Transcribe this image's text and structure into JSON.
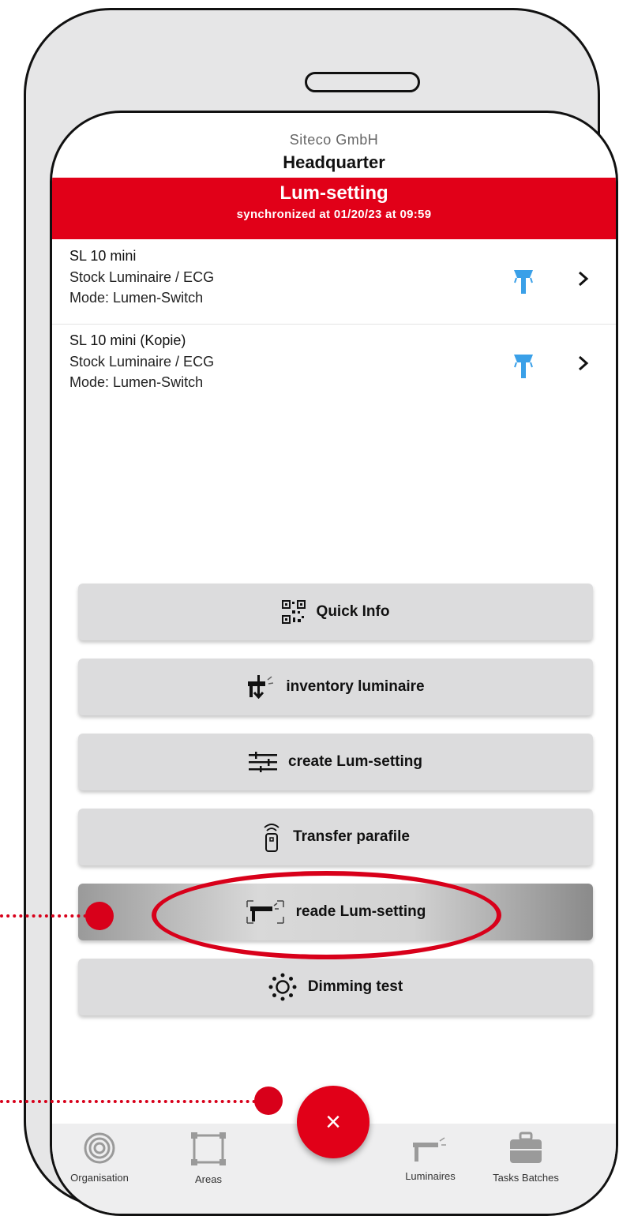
{
  "header": {
    "organisation": "Siteco GmbH",
    "site": "Headquarter"
  },
  "banner": {
    "title": "Lum-setting",
    "subtitle": "synchronized at 01/20/23 at 09:59",
    "color": "#e10018"
  },
  "items": [
    {
      "name": "SL 10 mini",
      "type": "Stock Luminaire / ECG",
      "mode": "Mode: Lumen-Switch",
      "icon": "luminaire-icon"
    },
    {
      "name": "SL 10 mini (Kopie)",
      "type": "Stock Luminaire / ECG",
      "mode": "Mode: Lumen-Switch",
      "icon": "luminaire-icon"
    }
  ],
  "actions": {
    "quick_info": "Quick Info",
    "inventory": "inventory luminaire",
    "create": "create Lum-setting",
    "transfer": "Transfer parafile",
    "read": "reade Lum-setting",
    "dimming": "Dimming test"
  },
  "fab": {
    "label": "×"
  },
  "tabs": {
    "organisation": "Organisation",
    "areas": "Areas",
    "luminaires": "Luminaires",
    "tasks": "Tasks Batches"
  },
  "colors": {
    "accent": "#e10018",
    "luminaire_icon": "#3aa0e8"
  }
}
